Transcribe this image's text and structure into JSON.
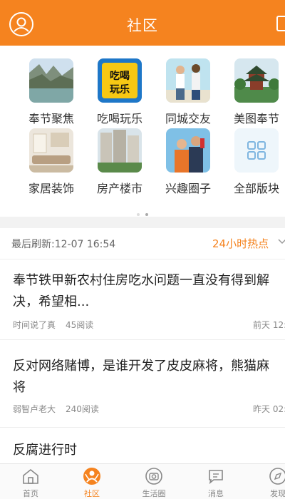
{
  "header": {
    "title": "社区"
  },
  "categories": [
    {
      "label": "奉节聚焦",
      "icon": "photo-gorge"
    },
    {
      "label": "吃喝玩乐",
      "icon": "eat-drink-play-logo",
      "logo_text": "吃喝玩乐"
    },
    {
      "label": "同城交友",
      "icon": "photo-friends"
    },
    {
      "label": "美图奉节",
      "icon": "photo-pavilion"
    },
    {
      "label": "家居装饰",
      "icon": "photo-living-room"
    },
    {
      "label": "房产楼市",
      "icon": "photo-buildings"
    },
    {
      "label": "兴趣圈子",
      "icon": "photo-couple"
    },
    {
      "label": "全部版块",
      "icon": "grid-icon"
    }
  ],
  "refresh": {
    "label": "最后刷新:12-07 16:54",
    "hot_label": "24小时热点",
    "hot_chevron": "chevron-down-icon"
  },
  "posts": [
    {
      "title_line1": "奉节铁甲新农村住房吃水问题一直没有得到解",
      "title_line2": "决，希望相...",
      "author": "时间说了真",
      "reads": "45阅读",
      "time": "前天 12:"
    },
    {
      "title_line1": "反对网络赌博，是谁开发了皮皮麻将，熊猫麻",
      "title_line2": "将",
      "author": "弱智卢老大",
      "reads": "240阅读",
      "time": "昨天 02:"
    },
    {
      "title_line1": "反腐进行时",
      "title_line2": "",
      "author": "",
      "reads": "",
      "time": ""
    }
  ],
  "nav": [
    {
      "label": "首页",
      "icon": "home-icon"
    },
    {
      "label": "社区",
      "icon": "community-icon",
      "active": true
    },
    {
      "label": "生活圈",
      "icon": "camera-icon"
    },
    {
      "label": "消息",
      "icon": "message-icon"
    },
    {
      "label": "发现",
      "icon": "discover-icon"
    }
  ],
  "colors": {
    "accent": "#f5831f",
    "background": "#ffffff",
    "separator": "#f2f2f2"
  }
}
